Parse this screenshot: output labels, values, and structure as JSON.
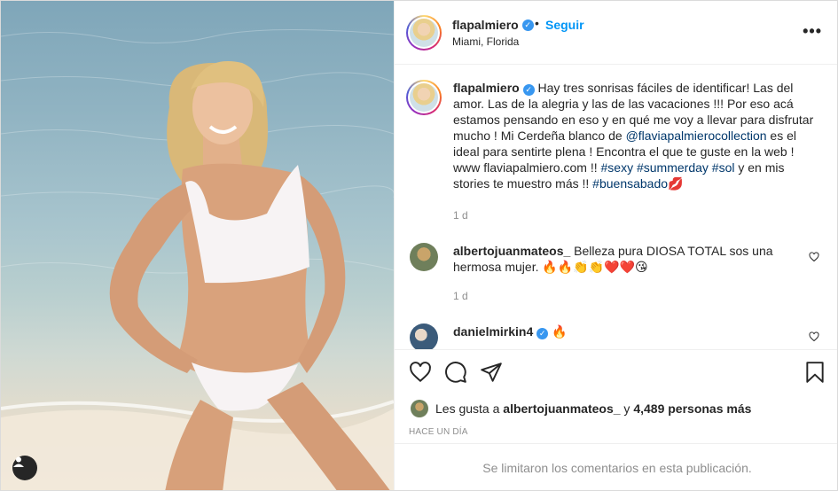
{
  "post": {
    "username": "flapalmiero",
    "follow_label": "Seguir",
    "separator": "•",
    "location": "Miami, Florida",
    "more_label": "•••"
  },
  "caption": {
    "username": "flapalmiero",
    "text_1": "Hay tres sonrisas fáciles de identificar! Las del amor. Las de la alegria y las de las vacaciones !!! Por eso acá estamos pensando en eso y en qué me voy a llevar para disfrutar mucho ! Mi Cerdeña blanco de ",
    "mention": "@flaviapalmierocollection",
    "text_2": " es el ideal para sentirte plena ! Encontra el que te guste en la web ! www flaviapalmiero.com !! ",
    "tag_1": "#sexy",
    "tag_2": "#summerday",
    "tag_3": "#sol",
    "text_3": " y en mis stories te muestro más !! ",
    "tag_4": "#buensabado",
    "emoji": "💋",
    "time": "1 d"
  },
  "comments": [
    {
      "username": "albertojuanmateos_",
      "text": "Belleza pura DIOSA TOTAL sos una hermosa mujer. ",
      "emojis": "🔥🔥👏👏❤️❤️😘",
      "time": "1 d"
    },
    {
      "username": "danielmirkin4",
      "emojis": "🔥"
    }
  ],
  "likes": {
    "prefix": "Les gusta a ",
    "user": "albertojuanmateos_",
    "middle": " y ",
    "count": "4,489 personas más"
  },
  "ago": "HACE UN DÍA",
  "limited_comments": "Se limitaron los comentarios en esta publicación.",
  "colors": {
    "accent": "#0095f6",
    "link": "#00376b",
    "muted": "#8e8e8e",
    "verified": "#3897f0"
  },
  "icons": [
    "heart-icon",
    "comment-icon",
    "share-icon",
    "bookmark-icon",
    "more-icon",
    "user-tag-icon"
  ]
}
